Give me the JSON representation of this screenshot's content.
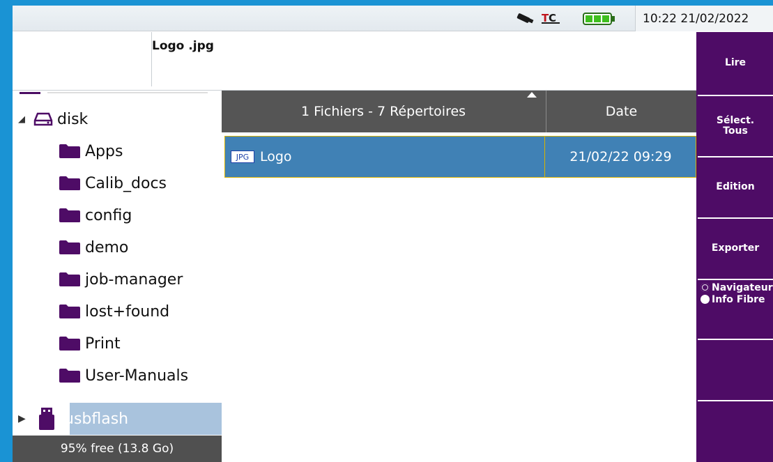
{
  "status_bar": {
    "clock": "10:22 21/02/2022",
    "usb_icon": "usb-stick-icon",
    "tc_icon": "tc-logo-icon",
    "battery_icon": "battery-full-icon"
  },
  "file_info": {
    "filename": "Logo .jpg"
  },
  "tree": {
    "root_label": "disk",
    "folders": [
      "Apps",
      "Calib_docs",
      "config",
      "demo",
      "job-manager",
      "lost+found",
      "Print",
      "User-Manuals"
    ],
    "usb_label": "usbflash",
    "free_space": "95% free (13.8 Go)"
  },
  "file_list": {
    "header_name": "1 Fichiers - 7 Répertoires",
    "header_date": "Date",
    "rows": [
      {
        "type_badge": "JPG",
        "name": "Logo",
        "date": "21/02/22 09:29"
      }
    ]
  },
  "side_menu": {
    "read": "Lire",
    "select_all_line1": "Sélect.",
    "select_all_line2": "Tous",
    "edit": "Edition",
    "export": "Exporter",
    "radio_navigate": "Navigateur",
    "radio_fiber_info": "Info Fibre"
  },
  "colors": {
    "accent_purple": "#4e0c66",
    "selection_blue": "#4081b5",
    "header_gray": "#555555",
    "frame_blue": "#1a93d4"
  }
}
